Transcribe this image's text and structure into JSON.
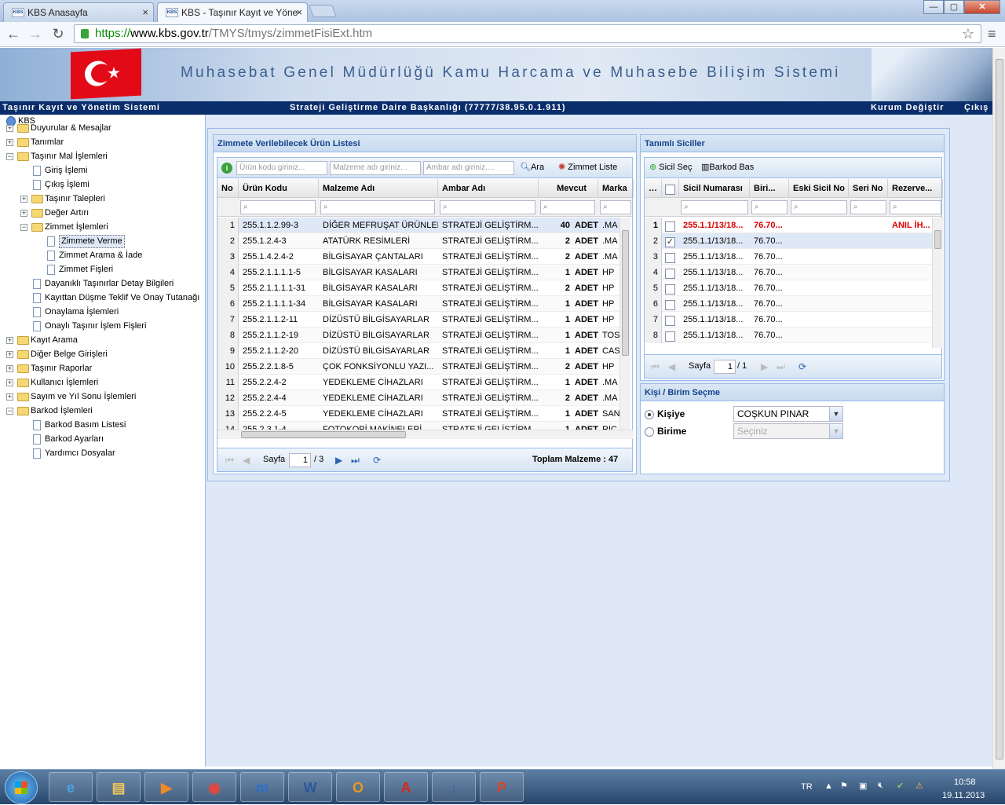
{
  "browser": {
    "tabs": [
      {
        "label": "KBS Anasayfa",
        "close": "×",
        "favicon": "KBS"
      },
      {
        "label": "KBS - Taşınır Kayıt ve Yöne",
        "close": "×",
        "favicon": "KBS"
      }
    ],
    "url_scheme": "https://",
    "url_host": "www.kbs.gov.tr",
    "url_path": "/TMYS/tmys/zimmetFisiExt.htm",
    "window": {
      "minimize": "—",
      "maximize": "▢",
      "close": "✕"
    }
  },
  "banner": {
    "title": "Muhasebat Genel Müdürlüğü Kamu Harcama ve Muhasebe Bilişim Sistemi"
  },
  "subbar": {
    "system": "Taşınır Kayıt ve Yönetim Sistemi",
    "org": "Strateji Geliştirme Daire Başkanlığı (77777/38.95.0.1.911)",
    "kurum": "Kurum Değiştir",
    "cikis": "Çıkış"
  },
  "tree": {
    "root": "KBS",
    "items": [
      {
        "label": "Duyurular & Mesajlar",
        "pm": "+"
      },
      {
        "label": "Tanımlar",
        "pm": "+"
      },
      {
        "label": "Taşınır Mal İşlemleri",
        "pm": "−"
      },
      {
        "label": "Giriş İşlemi"
      },
      {
        "label": "Çıkış İşlemi"
      },
      {
        "label": "Taşınır Talepleri",
        "pm": "+"
      },
      {
        "label": "Değer Artırı",
        "pm": "+"
      },
      {
        "label": "Zimmet İşlemleri",
        "pm": "−"
      },
      {
        "label": "Zimmete Verme"
      },
      {
        "label": "Zimmet Arama & İade"
      },
      {
        "label": "Zimmet Fişleri"
      },
      {
        "label": "Dayanıklı Taşınırlar Detay Bilgileri"
      },
      {
        "label": "Kayıttan Düşme Teklif Ve Onay Tutanağı"
      },
      {
        "label": "Onaylama İşlemleri"
      },
      {
        "label": "Onaylı Taşınır İşlem Fişleri"
      },
      {
        "label": "Kayıt Arama",
        "pm": "+"
      },
      {
        "label": "Diğer Belge Girişleri",
        "pm": "+"
      },
      {
        "label": "Taşınır Raporlar",
        "pm": "+"
      },
      {
        "label": "Kullanıcı İşlemleri",
        "pm": "+"
      },
      {
        "label": "Sayım ve Yıl Sonu İşlemleri",
        "pm": "+"
      },
      {
        "label": "Barkod İşlemleri",
        "pm": "−"
      },
      {
        "label": "Barkod Basım Listesi"
      },
      {
        "label": "Barkod Ayarları"
      },
      {
        "label": "Yardımcı Dosyalar"
      }
    ]
  },
  "products": {
    "title": "Zimmete Verilebilecek Ürün Listesi",
    "search": {
      "code_placeholder": "Ürün kodu giriniz...",
      "name_placeholder": "Malzeme adı giriniz...",
      "store_placeholder": "Ambar adı giriniz....",
      "search_label": "Ara",
      "zimmet_label": "Zimmet Liste"
    },
    "columns": [
      "No",
      "Ürün Kodu",
      "Malzeme Adı",
      "Ambar Adı",
      "Mevcut",
      "Marka"
    ],
    "rows": [
      [
        "1",
        "255.1.1.2.99-3",
        "DİĞER MEFRUŞAT ÜRÜNLERİ",
        "STRATEJİ GELİŞTİRM...",
        "40",
        "ADET",
        ".MA"
      ],
      [
        "2",
        "255.1.2.4-3",
        "ATATÜRK RESİMLERİ",
        "STRATEJİ GELİŞTİRM...",
        "2",
        "ADET",
        ".MA"
      ],
      [
        "3",
        "255.1.4.2.4-2",
        "BİLGİSAYAR ÇANTALARI",
        "STRATEJİ GELİŞTİRM...",
        "2",
        "ADET",
        ".MA"
      ],
      [
        "4",
        "255.2.1.1.1.1-5",
        "BİLGİSAYAR KASALARI",
        "STRATEJİ GELİŞTİRM...",
        "1",
        "ADET",
        "HP"
      ],
      [
        "5",
        "255.2.1.1.1.1-31",
        "BİLGİSAYAR KASALARI",
        "STRATEJİ GELİŞTİRM...",
        "2",
        "ADET",
        "HP"
      ],
      [
        "6",
        "255.2.1.1.1.1-34",
        "BİLGİSAYAR KASALARI",
        "STRATEJİ GELİŞTİRM...",
        "1",
        "ADET",
        "HP"
      ],
      [
        "7",
        "255.2.1.1.2-11",
        "DİZÜSTÜ BİLGİSAYARLAR",
        "STRATEJİ GELİŞTİRM...",
        "1",
        "ADET",
        "HP"
      ],
      [
        "8",
        "255.2.1.1.2-19",
        "DİZÜSTÜ BİLGİSAYARLAR",
        "STRATEJİ GELİŞTİRM...",
        "1",
        "ADET",
        "TOS"
      ],
      [
        "9",
        "255.2.1.1.2-20",
        "DİZÜSTÜ BİLGİSAYARLAR",
        "STRATEJİ GELİŞTİRM...",
        "1",
        "ADET",
        "CAS"
      ],
      [
        "10",
        "255.2.2.1.8-5",
        "ÇOK FONKSİYONLU YAZI...",
        "STRATEJİ GELİŞTİRM...",
        "2",
        "ADET",
        "HP"
      ],
      [
        "11",
        "255.2.2.4-2",
        "YEDEKLEME CİHAZLARI",
        "STRATEJİ GELİŞTİRM...",
        "1",
        "ADET",
        ".MA"
      ],
      [
        "12",
        "255.2.2.4-4",
        "YEDEKLEME CİHAZLARI",
        "STRATEJİ GELİŞTİRM...",
        "2",
        "ADET",
        ".MA"
      ],
      [
        "13",
        "255.2.2.4-5",
        "YEDEKLEME CİHAZLARI",
        "STRATEJİ GELİŞTİRM...",
        "1",
        "ADET",
        "SAN"
      ],
      [
        "14",
        "255.2.3.1-4",
        "FOTOKOPİ MAKİNELERİ",
        "STRATEJİ GELİŞTİRM...",
        "1",
        "ADET",
        "RIC"
      ]
    ],
    "pager": {
      "label": "Sayfa",
      "page": "1",
      "of": "/ 3",
      "total": "Toplam Malzeme : 47"
    }
  },
  "siciller": {
    "title": "Tanımlı Siciller",
    "toolbar": {
      "sec": "Sicil Seç",
      "barkod": "Barkod Bas"
    },
    "columns": [
      "Sicil Numarası",
      "Biri...",
      "Eski Sicil No",
      "Seri No",
      "Rezerve..."
    ],
    "rows": [
      {
        "n": "1",
        "sicil": "255.1.1/13/18...",
        "birim": "76.70...",
        "rezerve": "ANIL İH...",
        "checked": false,
        "red": true
      },
      {
        "n": "2",
        "sicil": "255.1.1/13/18...",
        "birim": "76.70...",
        "rezerve": "",
        "checked": true,
        "red": false
      },
      {
        "n": "3",
        "sicil": "255.1.1/13/18...",
        "birim": "76.70...",
        "rezerve": "",
        "checked": false,
        "red": false
      },
      {
        "n": "4",
        "sicil": "255.1.1/13/18...",
        "birim": "76.70...",
        "rezerve": "",
        "checked": false,
        "red": false
      },
      {
        "n": "5",
        "sicil": "255.1.1/13/18...",
        "birim": "76.70...",
        "rezerve": "",
        "checked": false,
        "red": false
      },
      {
        "n": "6",
        "sicil": "255.1.1/13/18...",
        "birim": "76.70...",
        "rezerve": "",
        "checked": false,
        "red": false
      },
      {
        "n": "7",
        "sicil": "255.1.1/13/18...",
        "birim": "76.70...",
        "rezerve": "",
        "checked": false,
        "red": false
      },
      {
        "n": "8",
        "sicil": "255.1.1/13/18...",
        "birim": "76.70...",
        "rezerve": "",
        "checked": false,
        "red": false
      }
    ],
    "pager": {
      "label": "Sayfa",
      "page": "1",
      "of": "/ 1"
    }
  },
  "kisi": {
    "title": "Kişi / Birim Seçme",
    "kisiye": "Kişiye",
    "birime": "Birime",
    "person": "COŞKUN PINAR",
    "birim_placeholder": "Seçiniz"
  },
  "taskbar": {
    "lang": "TR",
    "time": "10:58",
    "date": "19.11.2013",
    "apps": [
      "e",
      "▤",
      "▶",
      "◉",
      "m",
      "W",
      "O",
      "A",
      "↓",
      "P"
    ]
  }
}
